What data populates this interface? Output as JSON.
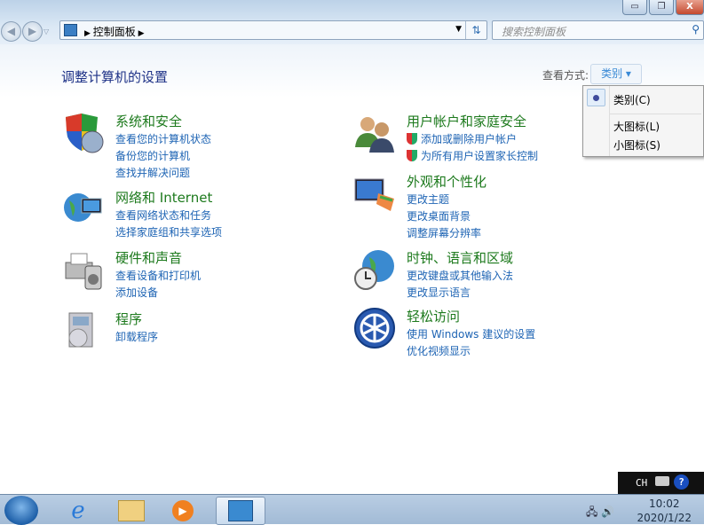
{
  "window": {
    "minimize": "▭",
    "restore": "❐",
    "close": "X"
  },
  "address": {
    "crumb": "控制面板",
    "search_placeholder": "搜索控制面板"
  },
  "main": {
    "heading": "调整计算机的设置",
    "view_by_label": "查看方式:",
    "view_by_value": "类别 ▾"
  },
  "menu": {
    "items": [
      "类别(C)",
      "大图标(L)",
      "小图标(S)"
    ],
    "selected": "类别(C)"
  },
  "categories": [
    {
      "title": "系统和安全",
      "links": [
        "查看您的计算机状态",
        "备份您的计算机",
        "查找并解决问题"
      ]
    },
    {
      "title": "网络和 Internet",
      "links": [
        "查看网络状态和任务",
        "选择家庭组和共享选项"
      ]
    },
    {
      "title": "硬件和声音",
      "links": [
        "查看设备和打印机",
        "添加设备"
      ]
    },
    {
      "title": "程序",
      "links": [
        "卸载程序"
      ]
    },
    {
      "title": "用户帐户和家庭安全",
      "links": [
        "添加或删除用户帐户",
        "为所有用户设置家长控制"
      ]
    },
    {
      "title": "外观和个性化",
      "links": [
        "更改主题",
        "更改桌面背景",
        "调整屏幕分辨率"
      ]
    },
    {
      "title": "时钟、语言和区域",
      "links": [
        "更改键盘或其他输入法",
        "更改显示语言"
      ]
    },
    {
      "title": "轻松访问",
      "links": [
        "使用 Windows 建议的设置",
        "优化视频显示"
      ]
    }
  ],
  "langbar": {
    "lang": "CH",
    "help": "?"
  },
  "clock": {
    "time": "10:02",
    "date": "2020/1/22"
  }
}
